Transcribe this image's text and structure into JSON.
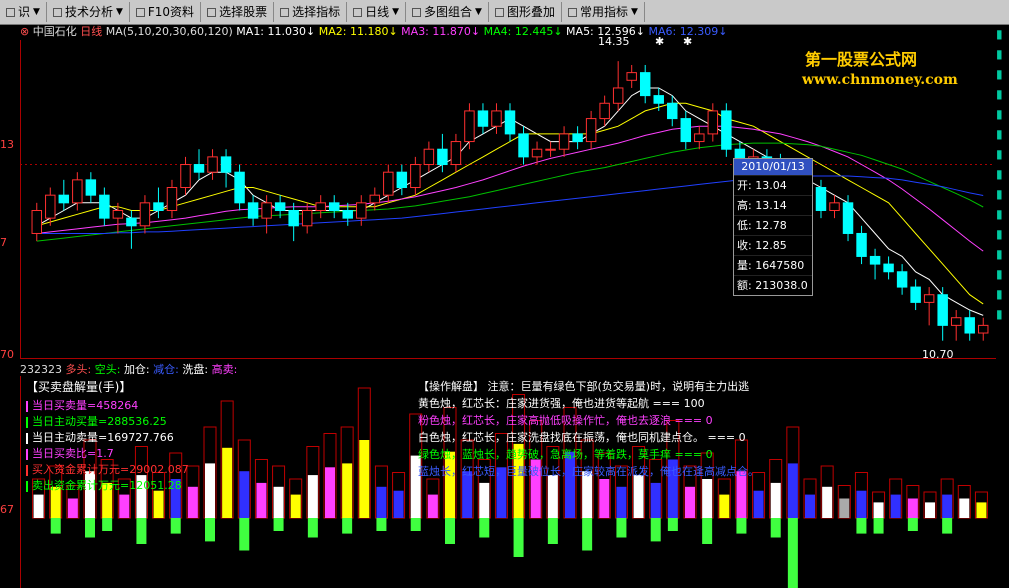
{
  "toolbar": {
    "items": [
      {
        "label": "识",
        "dropdown": true
      },
      {
        "label": "技术分析",
        "dropdown": true
      },
      {
        "label": "F10资料",
        "dropdown": false
      },
      {
        "label": "选择股票",
        "dropdown": false
      },
      {
        "label": "选择指标",
        "dropdown": false
      },
      {
        "label": "日线",
        "dropdown": true
      },
      {
        "label": "多图组合",
        "dropdown": true
      },
      {
        "label": "图形叠加",
        "dropdown": false
      },
      {
        "label": "常用指标",
        "dropdown": true
      }
    ]
  },
  "header": {
    "stock": "中国石化",
    "period": "日线",
    "ma_params": "MA(5,10,20,30,60,120)",
    "ma1": "MA1: 11.030↓",
    "ma2": "MA2: 11.180↓",
    "ma3": "MA3: 11.870↓",
    "ma4": "MA4: 12.445↓",
    "ma5": "MA5: 12.596↓",
    "ma6": "MA6: 12.309↓"
  },
  "axis": {
    "label_top": "13",
    "label_mid": "7",
    "label_low": "70",
    "label_lower": "67"
  },
  "annotations": {
    "high": "14.35",
    "low": "10.70"
  },
  "watermark": {
    "title": "第一股票公式网",
    "url": "www.chnmoney.com"
  },
  "tooltip": {
    "date": "2010/01/13",
    "rows": [
      "开: 13.04",
      "高: 13.14",
      "低: 12.78",
      "收: 12.85",
      "量: 1647580",
      "额: 213038.0"
    ]
  },
  "sub_legend": {
    "code": "232323",
    "duo": "多头:",
    "kong": "空头:",
    "jiacang": "加仓:",
    "jiancang": "减仓:",
    "xipan": "洗盘:",
    "gaomai": "高卖:"
  },
  "lower": {
    "title": "【买卖盘解量(手)】",
    "values": [
      {
        "text": "当日买卖量=458264",
        "color": "#ff40ff"
      },
      {
        "text": "当日主动买量=288536.25",
        "color": "#00ff00"
      },
      {
        "text": "当日主动卖量=169727.766",
        "color": "#ffffff"
      },
      {
        "text": "当日买卖比=1.7",
        "color": "#ff40ff"
      },
      {
        "text": "买入资金累计万元=29002.087",
        "color": "#ff3030"
      },
      {
        "text": "卖出资金累计万元=12051.28",
        "color": "#00ff00"
      }
    ]
  },
  "notes": [
    {
      "text": "【操作解盘】 注意：巨量有绿色下部(负交易量)时，说明有主力出逃",
      "color": "#ffffff"
    },
    {
      "text": "黄色烛，红芯长：庄家进货强，俺也进货等起航 === 100",
      "color": "#ffffff"
    },
    {
      "text": "粉色烛，红芯长，庄家高抛低吸操作忙，俺也去逐浪 === 0",
      "color": "#ff40ff"
    },
    {
      "text": "白色烛，红芯长，庄家洗盘找底在振荡，俺也同机建点仓。 === 0",
      "color": "#ffffff"
    },
    {
      "text": "绿色烛，蓝烛长，趋势破，急离场，等着跌，莫手痒 === 0",
      "color": "#00ff00"
    },
    {
      "text": "蓝烛长，红芯短，巨量破位长，庄家较高在派发，俺也在逢高减点仓。",
      "color": "#3a5cff"
    }
  ],
  "chart_data": {
    "type": "candlestick",
    "annotations": [
      "14.35",
      "10.70"
    ],
    "candles": [
      {
        "o": 12.1,
        "c": 12.4,
        "h": 12.5,
        "l": 12.0
      },
      {
        "o": 12.3,
        "c": 12.6,
        "h": 12.7,
        "l": 12.2
      },
      {
        "o": 12.6,
        "c": 12.5,
        "h": 12.8,
        "l": 12.4
      },
      {
        "o": 12.5,
        "c": 12.8,
        "h": 12.9,
        "l": 12.4
      },
      {
        "o": 12.8,
        "c": 12.6,
        "h": 12.9,
        "l": 12.5
      },
      {
        "o": 12.6,
        "c": 12.3,
        "h": 12.7,
        "l": 12.2
      },
      {
        "o": 12.3,
        "c": 12.4,
        "h": 12.5,
        "l": 12.1
      },
      {
        "o": 12.3,
        "c": 12.2,
        "h": 12.4,
        "l": 11.9
      },
      {
        "o": 12.2,
        "c": 12.5,
        "h": 12.6,
        "l": 12.1
      },
      {
        "o": 12.5,
        "c": 12.4,
        "h": 12.7,
        "l": 12.3
      },
      {
        "o": 12.4,
        "c": 12.7,
        "h": 12.8,
        "l": 12.3
      },
      {
        "o": 12.7,
        "c": 13.0,
        "h": 13.1,
        "l": 12.6
      },
      {
        "o": 13.0,
        "c": 12.9,
        "h": 13.2,
        "l": 12.8
      },
      {
        "o": 12.9,
        "c": 13.1,
        "h": 13.2,
        "l": 12.8
      },
      {
        "o": 13.1,
        "c": 12.9,
        "h": 13.2,
        "l": 12.7
      },
      {
        "o": 12.9,
        "c": 12.5,
        "h": 13.0,
        "l": 12.4
      },
      {
        "o": 12.5,
        "c": 12.3,
        "h": 12.6,
        "l": 12.2
      },
      {
        "o": 12.3,
        "c": 12.5,
        "h": 12.6,
        "l": 12.1
      },
      {
        "o": 12.5,
        "c": 12.4,
        "h": 12.6,
        "l": 12.3
      },
      {
        "o": 12.4,
        "c": 12.2,
        "h": 12.5,
        "l": 12.0
      },
      {
        "o": 12.2,
        "c": 12.4,
        "h": 12.5,
        "l": 12.1
      },
      {
        "o": 12.4,
        "c": 12.5,
        "h": 12.6,
        "l": 12.3
      },
      {
        "o": 12.5,
        "c": 12.4,
        "h": 12.6,
        "l": 12.3
      },
      {
        "o": 12.4,
        "c": 12.3,
        "h": 12.5,
        "l": 12.2
      },
      {
        "o": 12.3,
        "c": 12.5,
        "h": 12.6,
        "l": 12.2
      },
      {
        "o": 12.5,
        "c": 12.6,
        "h": 12.7,
        "l": 12.4
      },
      {
        "o": 12.6,
        "c": 12.9,
        "h": 13.0,
        "l": 12.5
      },
      {
        "o": 12.9,
        "c": 12.7,
        "h": 13.0,
        "l": 12.6
      },
      {
        "o": 12.7,
        "c": 13.0,
        "h": 13.1,
        "l": 12.6
      },
      {
        "o": 13.0,
        "c": 13.2,
        "h": 13.3,
        "l": 12.9
      },
      {
        "o": 13.2,
        "c": 13.0,
        "h": 13.4,
        "l": 12.9
      },
      {
        "o": 13.0,
        "c": 13.3,
        "h": 13.4,
        "l": 12.9
      },
      {
        "o": 13.3,
        "c": 13.7,
        "h": 13.8,
        "l": 13.2
      },
      {
        "o": 13.7,
        "c": 13.5,
        "h": 13.8,
        "l": 13.4
      },
      {
        "o": 13.5,
        "c": 13.7,
        "h": 13.8,
        "l": 13.4
      },
      {
        "o": 13.7,
        "c": 13.4,
        "h": 13.8,
        "l": 13.3
      },
      {
        "o": 13.4,
        "c": 13.1,
        "h": 13.5,
        "l": 13.0
      },
      {
        "o": 13.1,
        "c": 13.2,
        "h": 13.3,
        "l": 13.0
      },
      {
        "o": 13.2,
        "c": 13.2,
        "h": 13.3,
        "l": 13.1
      },
      {
        "o": 13.2,
        "c": 13.4,
        "h": 13.5,
        "l": 13.1
      },
      {
        "o": 13.4,
        "c": 13.3,
        "h": 13.5,
        "l": 13.2
      },
      {
        "o": 13.3,
        "c": 13.6,
        "h": 13.7,
        "l": 13.2
      },
      {
        "o": 13.6,
        "c": 13.8,
        "h": 13.9,
        "l": 13.5
      },
      {
        "o": 13.8,
        "c": 14.0,
        "h": 14.35,
        "l": 13.7
      },
      {
        "o": 14.1,
        "c": 14.2,
        "h": 14.3,
        "l": 14.0
      },
      {
        "o": 14.2,
        "c": 13.9,
        "h": 14.3,
        "l": 13.8
      },
      {
        "o": 13.9,
        "c": 13.8,
        "h": 14.0,
        "l": 13.7
      },
      {
        "o": 13.8,
        "c": 13.6,
        "h": 13.9,
        "l": 13.5
      },
      {
        "o": 13.6,
        "c": 13.3,
        "h": 13.7,
        "l": 13.2
      },
      {
        "o": 13.3,
        "c": 13.4,
        "h": 13.5,
        "l": 13.2
      },
      {
        "o": 13.4,
        "c": 13.7,
        "h": 13.8,
        "l": 13.3
      },
      {
        "o": 13.7,
        "c": 13.2,
        "h": 13.8,
        "l": 13.1
      },
      {
        "o": 13.2,
        "c": 13.0,
        "h": 13.3,
        "l": 12.9
      },
      {
        "o": 13.0,
        "c": 13.1,
        "h": 13.2,
        "l": 12.9
      },
      {
        "o": 13.1,
        "c": 13.0,
        "h": 13.2,
        "l": 12.9
      },
      {
        "o": 13.04,
        "c": 12.85,
        "h": 13.14,
        "l": 12.78
      },
      {
        "o": 12.9,
        "c": 12.6,
        "h": 13.0,
        "l": 12.5
      },
      {
        "o": 12.6,
        "c": 12.7,
        "h": 12.8,
        "l": 12.5
      },
      {
        "o": 12.7,
        "c": 12.4,
        "h": 12.8,
        "l": 12.3
      },
      {
        "o": 12.4,
        "c": 12.5,
        "h": 12.6,
        "l": 12.3
      },
      {
        "o": 12.5,
        "c": 12.1,
        "h": 12.6,
        "l": 12.0
      },
      {
        "o": 12.1,
        "c": 11.8,
        "h": 12.2,
        "l": 11.7
      },
      {
        "o": 11.8,
        "c": 11.7,
        "h": 11.9,
        "l": 11.5
      },
      {
        "o": 11.7,
        "c": 11.6,
        "h": 11.8,
        "l": 11.5
      },
      {
        "o": 11.6,
        "c": 11.4,
        "h": 11.7,
        "l": 11.3
      },
      {
        "o": 11.4,
        "c": 11.2,
        "h": 11.5,
        "l": 11.1
      },
      {
        "o": 11.2,
        "c": 11.3,
        "h": 11.4,
        "l": 10.9
      },
      {
        "o": 11.3,
        "c": 10.9,
        "h": 11.4,
        "l": 10.7
      },
      {
        "o": 10.9,
        "c": 11.0,
        "h": 11.1,
        "l": 10.7
      },
      {
        "o": 11.0,
        "c": 10.8,
        "h": 11.1,
        "l": 10.7
      },
      {
        "o": 10.8,
        "c": 10.9,
        "h": 11.0,
        "l": 10.7
      }
    ],
    "ma_lines": [
      {
        "name": "MA1",
        "color": "#ffffff",
        "values": [
          12.2,
          12.3,
          12.4,
          12.5,
          12.5,
          12.5,
          12.4,
          12.3,
          12.3,
          12.4,
          12.5,
          12.6,
          12.8,
          12.9,
          12.9,
          12.8,
          12.6,
          12.5,
          12.4,
          12.4,
          12.4,
          12.4,
          12.4,
          12.4,
          12.4,
          12.5,
          12.6,
          12.7,
          12.8,
          12.9,
          13.0,
          13.1,
          13.3,
          13.4,
          13.5,
          13.6,
          13.5,
          13.4,
          13.3,
          13.3,
          13.3,
          13.4,
          13.5,
          13.7,
          13.9,
          14.0,
          14.0,
          13.9,
          13.7,
          13.6,
          13.5,
          13.4,
          13.3,
          13.2,
          13.1,
          13.0,
          12.9,
          12.8,
          12.7,
          12.6,
          12.5,
          12.3,
          12.1,
          11.9,
          11.8,
          11.6,
          11.5,
          11.3,
          11.2,
          11.1,
          11.03
        ]
      },
      {
        "name": "MA2",
        "color": "#ffff00",
        "values": [
          12.2,
          12.25,
          12.3,
          12.35,
          12.4,
          12.45,
          12.45,
          12.4,
          12.4,
          12.4,
          12.45,
          12.5,
          12.55,
          12.6,
          12.65,
          12.7,
          12.7,
          12.65,
          12.6,
          12.55,
          12.5,
          12.45,
          12.45,
          12.45,
          12.45,
          12.45,
          12.5,
          12.55,
          12.6,
          12.7,
          12.8,
          12.9,
          13.0,
          13.1,
          13.2,
          13.3,
          13.4,
          13.4,
          13.4,
          13.4,
          13.4,
          13.4,
          13.45,
          13.5,
          13.6,
          13.7,
          13.75,
          13.8,
          13.8,
          13.75,
          13.7,
          13.6,
          13.55,
          13.5,
          13.4,
          13.3,
          13.2,
          13.1,
          13.0,
          12.9,
          12.8,
          12.7,
          12.6,
          12.5,
          12.3,
          12.1,
          11.9,
          11.7,
          11.5,
          11.3,
          11.18
        ]
      },
      {
        "name": "MA3",
        "color": "#ff40ff",
        "values": [
          12.1,
          12.12,
          12.14,
          12.16,
          12.18,
          12.2,
          12.22,
          12.23,
          12.24,
          12.26,
          12.28,
          12.3,
          12.33,
          12.36,
          12.39,
          12.41,
          12.42,
          12.43,
          12.44,
          12.45,
          12.45,
          12.45,
          12.46,
          12.47,
          12.48,
          12.5,
          12.52,
          12.55,
          12.58,
          12.62,
          12.66,
          12.7,
          12.75,
          12.8,
          12.86,
          12.92,
          12.98,
          13.03,
          13.08,
          13.12,
          13.16,
          13.2,
          13.24,
          13.28,
          13.33,
          13.38,
          13.42,
          13.46,
          13.48,
          13.5,
          13.5,
          13.5,
          13.48,
          13.46,
          13.43,
          13.4,
          13.35,
          13.3,
          13.24,
          13.17,
          13.1,
          13.0,
          12.9,
          12.8,
          12.68,
          12.55,
          12.42,
          12.28,
          12.14,
          12.0,
          11.87
        ]
      },
      {
        "name": "MA4",
        "color": "#00c000",
        "values": [
          12.0,
          12.02,
          12.04,
          12.06,
          12.08,
          12.1,
          12.12,
          12.14,
          12.16,
          12.18,
          12.2,
          12.22,
          12.24,
          12.26,
          12.28,
          12.3,
          12.32,
          12.33,
          12.34,
          12.35,
          12.36,
          12.37,
          12.38,
          12.39,
          12.4,
          12.41,
          12.42,
          12.44,
          12.46,
          12.49,
          12.52,
          12.55,
          12.58,
          12.62,
          12.66,
          12.7,
          12.74,
          12.78,
          12.82,
          12.86,
          12.9,
          12.93,
          12.96,
          13.0,
          13.04,
          13.08,
          13.12,
          13.16,
          13.19,
          13.22,
          13.24,
          13.26,
          13.27,
          13.28,
          13.28,
          13.28,
          13.27,
          13.26,
          13.24,
          13.2,
          13.16,
          13.12,
          13.06,
          13.0,
          12.94,
          12.86,
          12.78,
          12.7,
          12.62,
          12.54,
          12.445
        ]
      },
      {
        "name": "MA5",
        "color": "#2040ff",
        "values": [
          12.1,
          12.1,
          12.1,
          12.1,
          12.1,
          12.1,
          12.11,
          12.11,
          12.12,
          12.12,
          12.13,
          12.14,
          12.15,
          12.16,
          12.17,
          12.18,
          12.19,
          12.2,
          12.21,
          12.22,
          12.23,
          12.24,
          12.25,
          12.26,
          12.27,
          12.28,
          12.29,
          12.3,
          12.32,
          12.34,
          12.36,
          12.38,
          12.4,
          12.42,
          12.44,
          12.46,
          12.48,
          12.5,
          12.52,
          12.54,
          12.56,
          12.58,
          12.6,
          12.62,
          12.64,
          12.66,
          12.68,
          12.7,
          12.72,
          12.74,
          12.76,
          12.78,
          12.8,
          12.81,
          12.82,
          12.83,
          12.84,
          12.85,
          12.85,
          12.85,
          12.85,
          12.84,
          12.83,
          12.82,
          12.8,
          12.77,
          12.74,
          12.71,
          12.67,
          12.63,
          12.596
        ]
      }
    ],
    "volume_bars": [
      {
        "v": 30,
        "neg": 0,
        "c": "#ffffff"
      },
      {
        "v": 40,
        "neg": 12,
        "c": "#ffff00"
      },
      {
        "v": 25,
        "neg": 0,
        "c": "#ff40ff"
      },
      {
        "v": 60,
        "neg": 15,
        "c": "#ffffff"
      },
      {
        "v": 45,
        "neg": 10,
        "c": "#ffff00"
      },
      {
        "v": 30,
        "neg": 0,
        "c": "#ff40ff"
      },
      {
        "v": 55,
        "neg": 20,
        "c": "#ffffff"
      },
      {
        "v": 35,
        "neg": 0,
        "c": "#ffff00"
      },
      {
        "v": 50,
        "neg": 12,
        "c": "#3030ff"
      },
      {
        "v": 40,
        "neg": 0,
        "c": "#ff40ff"
      },
      {
        "v": 70,
        "neg": 18,
        "c": "#ffffff"
      },
      {
        "v": 90,
        "neg": 0,
        "c": "#ffff00"
      },
      {
        "v": 60,
        "neg": 25,
        "c": "#3030ff"
      },
      {
        "v": 45,
        "neg": 0,
        "c": "#ff40ff"
      },
      {
        "v": 40,
        "neg": 10,
        "c": "#ffffff"
      },
      {
        "v": 30,
        "neg": 0,
        "c": "#ffff00"
      },
      {
        "v": 55,
        "neg": 15,
        "c": "#ffffff"
      },
      {
        "v": 65,
        "neg": 0,
        "c": "#ff40ff"
      },
      {
        "v": 70,
        "neg": 12,
        "c": "#ffff00"
      },
      {
        "v": 100,
        "neg": 0,
        "c": "#ffff00"
      },
      {
        "v": 40,
        "neg": 10,
        "c": "#3030ff"
      },
      {
        "v": 35,
        "neg": 0,
        "c": "#3030ff"
      },
      {
        "v": 80,
        "neg": 10,
        "c": "#ffffff"
      },
      {
        "v": 30,
        "neg": 0,
        "c": "#ff40ff"
      },
      {
        "v": 85,
        "neg": 20,
        "c": "#ffff00"
      },
      {
        "v": 60,
        "neg": 0,
        "c": "#3030ff"
      },
      {
        "v": 45,
        "neg": 15,
        "c": "#ffffff"
      },
      {
        "v": 65,
        "neg": 0,
        "c": "#3030ff"
      },
      {
        "v": 95,
        "neg": 30,
        "c": "#ffff00"
      },
      {
        "v": 75,
        "neg": 0,
        "c": "#ff40ff"
      },
      {
        "v": 55,
        "neg": 20,
        "c": "#ffffff"
      },
      {
        "v": 85,
        "neg": 0,
        "c": "#3030ff"
      },
      {
        "v": 60,
        "neg": 25,
        "c": "#ffffff"
      },
      {
        "v": 50,
        "neg": 0,
        "c": "#ff40ff"
      },
      {
        "v": 40,
        "neg": 15,
        "c": "#3030ff"
      },
      {
        "v": 55,
        "neg": 0,
        "c": "#ffffff"
      },
      {
        "v": 45,
        "neg": 18,
        "c": "#3030ff"
      },
      {
        "v": 75,
        "neg": 10,
        "c": "#3030ff"
      },
      {
        "v": 40,
        "neg": 0,
        "c": "#ff40ff"
      },
      {
        "v": 50,
        "neg": 20,
        "c": "#ffffff"
      },
      {
        "v": 30,
        "neg": 0,
        "c": "#ffff00"
      },
      {
        "v": 60,
        "neg": 12,
        "c": "#ff40ff"
      },
      {
        "v": 35,
        "neg": 0,
        "c": "#3030ff"
      },
      {
        "v": 45,
        "neg": 15,
        "c": "#ffffff"
      },
      {
        "v": 70,
        "neg": 55,
        "c": "#3030ff"
      },
      {
        "v": 30,
        "neg": 0,
        "c": "#3030ff"
      },
      {
        "v": 40,
        "neg": 0,
        "c": "#ffffff"
      },
      {
        "v": 25,
        "neg": 0,
        "c": "#aaaaaa"
      },
      {
        "v": 35,
        "neg": 12,
        "c": "#3030ff"
      },
      {
        "v": 20,
        "neg": 12,
        "c": "#ffffff"
      },
      {
        "v": 30,
        "neg": 0,
        "c": "#3030ff"
      },
      {
        "v": 25,
        "neg": 10,
        "c": "#ff40ff"
      },
      {
        "v": 20,
        "neg": 0,
        "c": "#ffffff"
      },
      {
        "v": 30,
        "neg": 12,
        "c": "#3030ff"
      },
      {
        "v": 25,
        "neg": 0,
        "c": "#ffffff"
      },
      {
        "v": 20,
        "neg": 0,
        "c": "#ffff00"
      }
    ]
  }
}
